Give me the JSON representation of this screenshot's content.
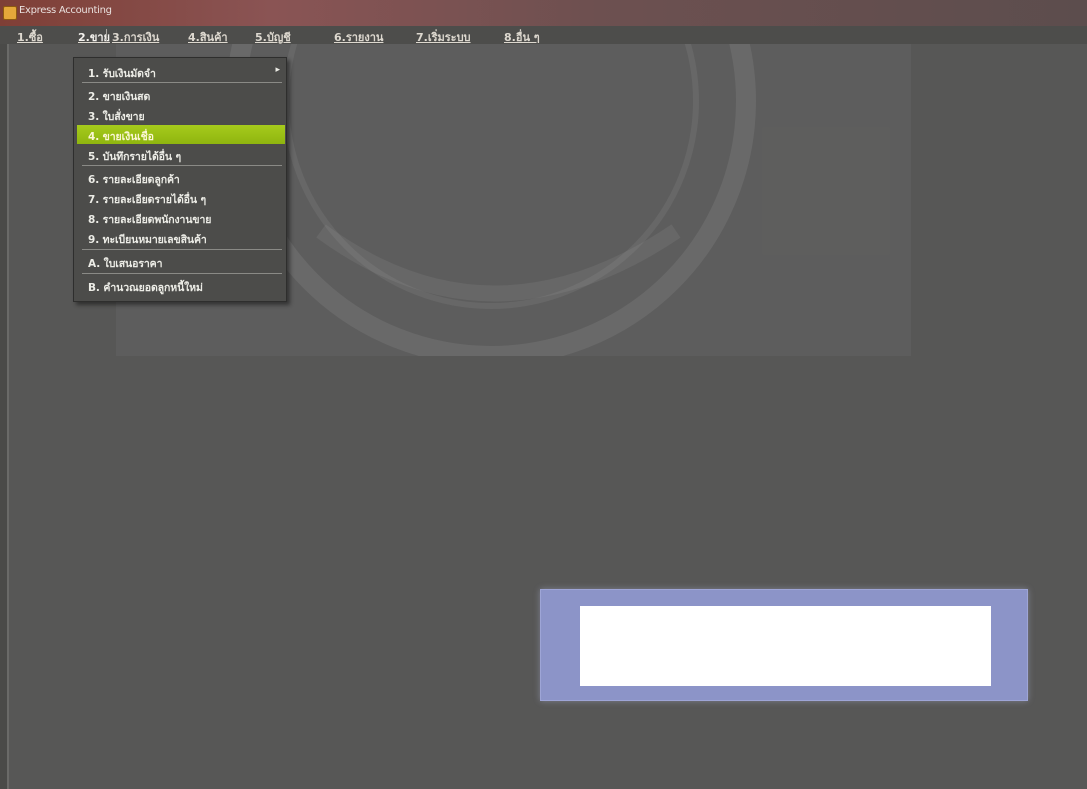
{
  "window": {
    "title": "Express Accounting",
    "icon": "app-icon"
  },
  "menubar": {
    "items": [
      {
        "label": "1.ซื้อ"
      },
      {
        "label": "2.ขาย"
      },
      {
        "label": "3.การเงิน"
      },
      {
        "label": "4.สินค้า"
      },
      {
        "label": "5.บัญชี"
      },
      {
        "label": "6.รายงาน"
      },
      {
        "label": "7.เริ่มระบบ"
      },
      {
        "label": "8.อื่น ๆ"
      }
    ],
    "active_index": 1
  },
  "dropdown": {
    "items": [
      {
        "label": "1. รับเงินมัดจำ",
        "has_submenu": true
      },
      {
        "label": "2. ขายเงินสด"
      },
      {
        "label": "3. ใบสั่งขาย"
      },
      {
        "label": "4. ขายเงินเชื่อ",
        "highlighted": true
      },
      {
        "label": "5. บันทึกรายได้อื่น ๆ"
      },
      {
        "label": "6. รายละเอียดลูกค้า"
      },
      {
        "label": "7. รายละเอียดรายได้อื่น ๆ"
      },
      {
        "label": "8. รายละเอียดพนักงานขาย"
      },
      {
        "label": "9. ทะเบียนหมายเลขสินค้า"
      },
      {
        "label": "A. ใบเสนอราคา"
      },
      {
        "label": "B. คำนวณยอดลูกหนี้ใหม่"
      }
    ],
    "highlight_color": "#9cc218"
  },
  "colors": {
    "titlebar": "#7f3f36",
    "client_background": "#575756",
    "dialog_frame": "#8c94c8"
  }
}
